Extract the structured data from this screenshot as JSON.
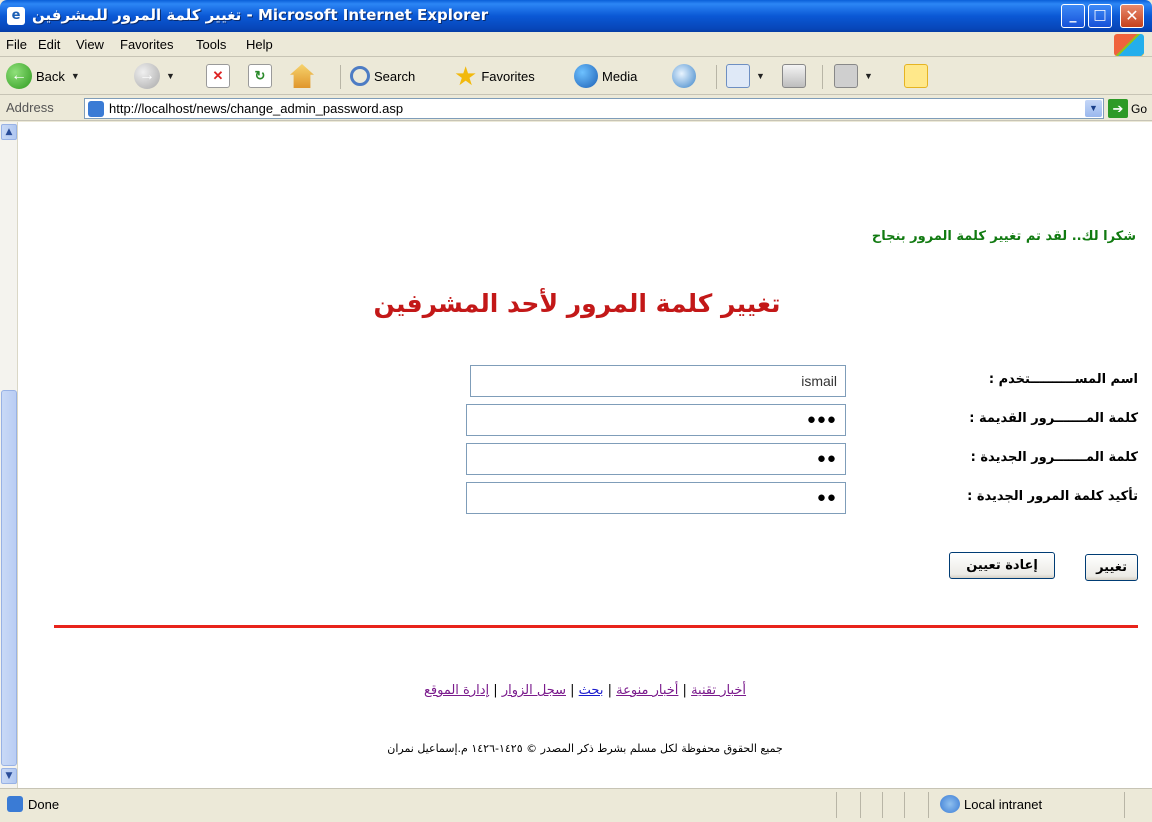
{
  "window": {
    "title": "تغيير كلمة المرور للمشرفين - Microsoft Internet Explorer",
    "icon": "ie-page-icon"
  },
  "menu": {
    "items": [
      "File",
      "Edit",
      "View",
      "Favorites",
      "Tools",
      "Help"
    ]
  },
  "toolbar": {
    "back_label": "Back",
    "search_label": "Search",
    "favorites_label": "Favorites",
    "media_label": "Media"
  },
  "address": {
    "label": "Address",
    "url": "http://localhost/news/change_admin_password.asp",
    "go_label": "Go"
  },
  "page": {
    "success_message": "شكرا لك.. لقد تم تغيير كلمة المرور بنجاح",
    "heading": "تغيير كلمة المرور لأحد المشرفين",
    "fields": {
      "username_label": "اسم المســــــــــتخدم :",
      "username_value": "ismail",
      "old_password_label": "كلمة المـــــــرور القديمة :",
      "old_password_value": "●●●",
      "new_password_label": "كلمة المـــــــرور الجديدة :",
      "new_password_value": "●●",
      "confirm_password_label": "تأكيد كلمة المرور الجديدة :",
      "confirm_password_value": "●●"
    },
    "buttons": {
      "submit_label": "تغيير",
      "reset_label": "إعادة تعيين"
    },
    "footer_nav": {
      "items": [
        "أخبار تقنية",
        "أخبار منوعة",
        "بحث",
        "سجل الزوار",
        "إدارة الموقع"
      ],
      "separator": "|"
    },
    "copyright": "جميع الحقوق محفوظة لكل مسلم بشرط ذكر المصدر © ١٤٢٥-١٤٢٦ م.إسماعيل نمران"
  },
  "status": {
    "text": "Done",
    "zone": "Local intranet"
  },
  "colors": {
    "success": "#117a11",
    "heading": "#c31818",
    "divider": "#e8231b",
    "visited_link": "#7a1a8c",
    "link": "#1a1acc"
  }
}
